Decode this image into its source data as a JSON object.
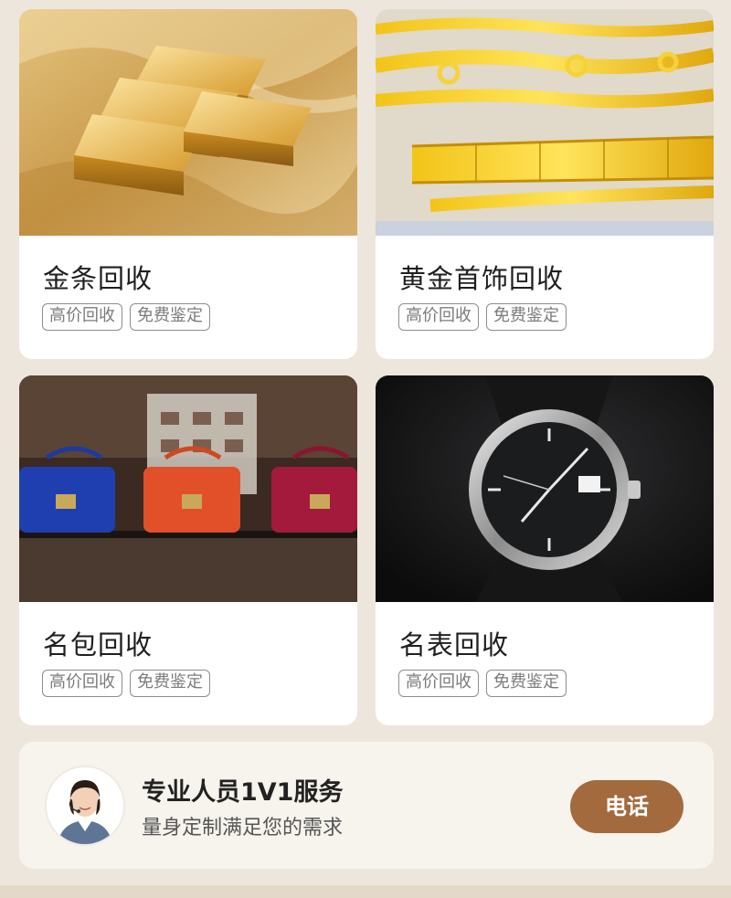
{
  "categories": [
    {
      "title": "金条回收",
      "tags": [
        "高价回收",
        "免费鉴定"
      ],
      "image": "gold-bars"
    },
    {
      "title": "黄金首饰回收",
      "tags": [
        "高价回收",
        "免费鉴定"
      ],
      "image": "gold-jewelry"
    },
    {
      "title": "名包回收",
      "tags": [
        "高价回收",
        "免费鉴定"
      ],
      "image": "handbags"
    },
    {
      "title": "名表回收",
      "tags": [
        "高价回收",
        "免费鉴定"
      ],
      "image": "watch"
    }
  ],
  "service": {
    "title": "专业人员1V1服务",
    "subtitle": "量身定制满足您的需求",
    "call_label": "电话"
  },
  "colors": {
    "page_bg": "#ede6dc",
    "card_bg": "#ffffff",
    "button_bg": "#a36a3e",
    "tag_border": "#8d8d8d"
  }
}
